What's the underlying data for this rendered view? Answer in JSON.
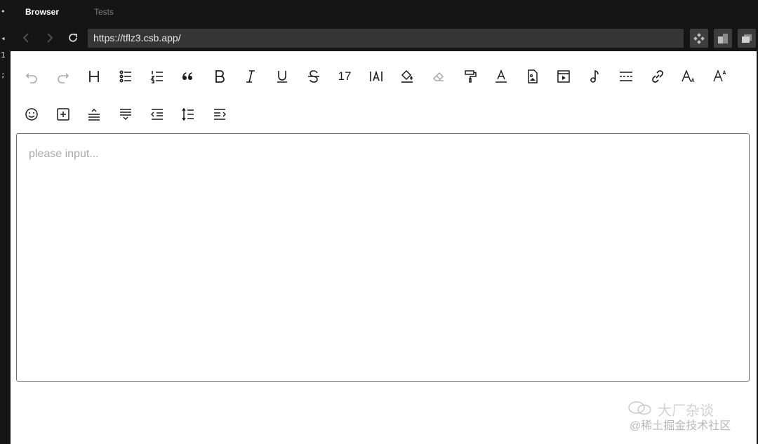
{
  "tabs": {
    "active": "Browser",
    "inactive": "Tests"
  },
  "address": {
    "url": "https://tflz3.csb.app/"
  },
  "toolbar": {
    "font_size": "17",
    "row1_icons": [
      "undo-icon",
      "redo-icon",
      "heading-icon",
      "bulleted-list-icon",
      "numbered-list-icon",
      "quote-icon",
      "bold-icon",
      "italic-icon",
      "underline-icon",
      "strikethrough-icon",
      "font-size-value",
      "letter-spacing-icon",
      "fill-color-icon",
      "eraser-icon",
      "format-painter-icon",
      "font-color-icon",
      "image-icon",
      "video-icon",
      "audio-icon",
      "divider-icon",
      "link-icon",
      "subscript-icon",
      "superscript-icon"
    ],
    "row2_icons": [
      "emoji-icon",
      "insert-box-icon",
      "align-center-icon",
      "align-bottom-icon",
      "indent-decrease-icon",
      "line-height-icon",
      "indent-increase-icon"
    ]
  },
  "editor": {
    "placeholder": "please input..."
  },
  "watermark": {
    "line1": "大厂杂谈",
    "line2": "@稀土掘金技术社区"
  },
  "colors": {
    "chrome_bg": "#151515",
    "url_bg": "#363636",
    "editor_border": "#6f6f6f"
  }
}
